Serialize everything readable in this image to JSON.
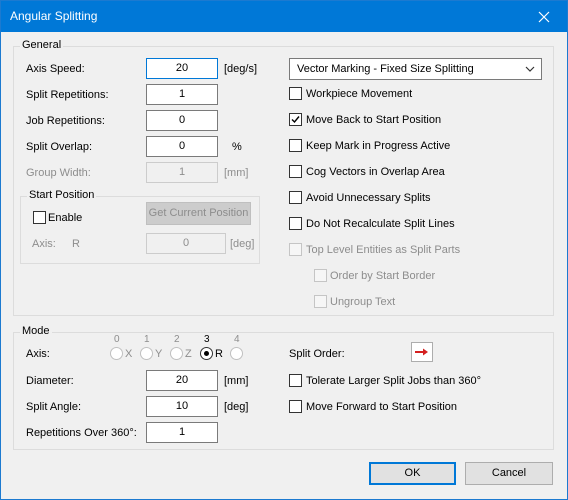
{
  "window": {
    "title": "Angular Splitting"
  },
  "general": {
    "label": "General",
    "axis_speed": {
      "label": "Axis Speed:",
      "value": "20",
      "unit": "[deg/s]"
    },
    "split_repetitions": {
      "label": "Split Repetitions:",
      "value": "1"
    },
    "job_repetitions": {
      "label": "Job Repetitions:",
      "value": "0"
    },
    "split_overlap": {
      "label": "Split Overlap:",
      "value": "0",
      "unit": "%"
    },
    "group_width": {
      "label": "Group Width:",
      "value": "1",
      "unit": "[mm]"
    },
    "start_position": {
      "label": "Start Position",
      "enable": {
        "label": "Enable",
        "checked": false
      },
      "get_current_label": "Get Current Position",
      "axis_label": "Axis:",
      "axis_value": "R",
      "position_value": "0",
      "unit": "[deg]"
    },
    "mode_select": {
      "value": "Vector Marking - Fixed Size Splitting"
    },
    "options": [
      {
        "label": "Workpiece Movement",
        "checked": false,
        "enabled": true
      },
      {
        "label": "Move Back to Start Position",
        "checked": true,
        "enabled": true
      },
      {
        "label": "Keep Mark in Progress Active",
        "checked": false,
        "enabled": true
      },
      {
        "label": "Cog Vectors in Overlap Area",
        "checked": false,
        "enabled": true
      },
      {
        "label": "Avoid Unnecessary Splits",
        "checked": false,
        "enabled": true
      },
      {
        "label": "Do Not Recalculate Split Lines",
        "checked": false,
        "enabled": true
      },
      {
        "label": "Top Level Entities as Split Parts",
        "checked": false,
        "enabled": false
      },
      {
        "label": "Order by Start Border",
        "checked": false,
        "enabled": false
      },
      {
        "label": "Ungroup Text",
        "checked": false,
        "enabled": false
      }
    ]
  },
  "mode": {
    "label": "Mode",
    "axis": {
      "label": "Axis:",
      "radios": [
        {
          "num": "0",
          "letter": "X",
          "selected": false
        },
        {
          "num": "1",
          "letter": "Y",
          "selected": false
        },
        {
          "num": "2",
          "letter": "Z",
          "selected": false
        },
        {
          "num": "3",
          "letter": "R",
          "selected": true
        },
        {
          "num": "4",
          "letter": "",
          "selected": false
        }
      ]
    },
    "diameter": {
      "label": "Diameter:",
      "value": "20",
      "unit": "[mm]"
    },
    "split_angle": {
      "label": "Split Angle:",
      "value": "10",
      "unit": "[deg]"
    },
    "repetitions_over_360": {
      "label": "Repetitions Over 360°:",
      "value": "1"
    },
    "split_order": {
      "label": "Split Order:",
      "icon": "right-arrow-icon"
    },
    "tolerate_larger": {
      "label": "Tolerate Larger Split Jobs than 360°",
      "checked": false
    },
    "move_forward": {
      "label": "Move Forward to Start Position",
      "checked": false
    }
  },
  "buttons": {
    "ok": "OK",
    "cancel": "Cancel"
  },
  "colors": {
    "titlebar": "#0078d7",
    "arrow": "#d42020"
  }
}
